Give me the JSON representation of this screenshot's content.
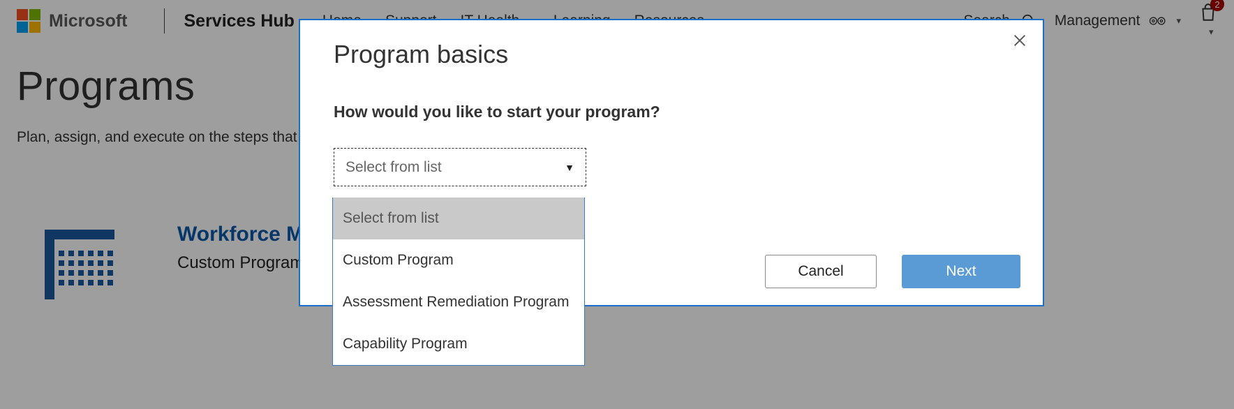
{
  "header": {
    "brand": "Microsoft",
    "hub": "Services Hub",
    "nav": {
      "home": "Home",
      "support": "Support",
      "ithealth": "IT Health",
      "learning": "Learning",
      "resources": "Resources"
    },
    "search_label": "Search",
    "management_label": "Management",
    "notification_count": "2"
  },
  "page": {
    "title": "Programs",
    "subtitle_visible": "Plan, assign, and execute on the steps that ",
    "card": {
      "title_visible": "Workforce Mod                                           t Teams",
      "subtitle": "Custom Program"
    }
  },
  "modal": {
    "title": "Program basics",
    "question": "How would you like to start your program?",
    "select_placeholder": "Select from list",
    "options": [
      "Select from list",
      "Custom Program",
      "Assessment Remediation Program",
      "Capability Program"
    ],
    "cancel_label": "Cancel",
    "next_label": "Next"
  }
}
